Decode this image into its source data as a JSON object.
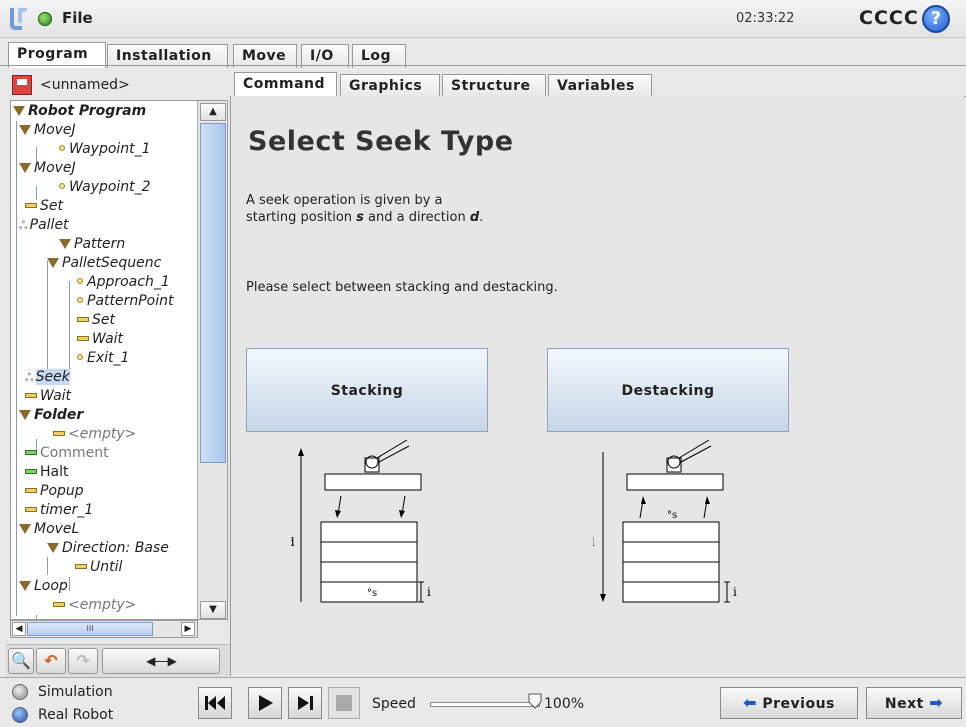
{
  "header": {
    "menu_label": "File",
    "clock": "02:33:22",
    "robot_name": "CCCC",
    "help_glyph": "?"
  },
  "main_tabs": [
    "Program",
    "Installation",
    "Move",
    "I/O",
    "Log"
  ],
  "program_name": "<unnamed>",
  "sub_tabs": [
    "Command",
    "Graphics",
    "Structure",
    "Variables"
  ],
  "tree": [
    {
      "label": "Robot Program"
    },
    {
      "label": "MoveJ"
    },
    {
      "label": "Waypoint_1"
    },
    {
      "label": "MoveJ"
    },
    {
      "label": "Waypoint_2"
    },
    {
      "label": "Set"
    },
    {
      "label": "Pallet"
    },
    {
      "label": "Pattern"
    },
    {
      "label": "PalletSequenc"
    },
    {
      "label": "Approach_1"
    },
    {
      "label": "PatternPoint"
    },
    {
      "label": "Set"
    },
    {
      "label": "Wait"
    },
    {
      "label": "Exit_1"
    },
    {
      "label": "Seek"
    },
    {
      "label": "Wait"
    },
    {
      "label": "Folder"
    },
    {
      "label": "<empty>"
    },
    {
      "label": "Comment"
    },
    {
      "label": "Halt"
    },
    {
      "label": "Popup"
    },
    {
      "label": "timer_1"
    },
    {
      "label": "MoveL"
    },
    {
      "label": "Direction: Base"
    },
    {
      "label": "Until"
    },
    {
      "label": "Loop"
    },
    {
      "label": "<empty>"
    }
  ],
  "tree_hscroll_glyph": "III",
  "toolbar": {
    "search_glyph": "🔍",
    "undo_glyph": "↶",
    "redo_glyph": "↷",
    "move_glyph": "◀----▶"
  },
  "content": {
    "title": "Select Seek Type",
    "desc_line1": "A seek operation is given by a",
    "desc_line2_prefix": "starting position ",
    "desc_s": "s",
    "desc_line2_mid": " and a direction ",
    "desc_d": "d",
    "desc_line2_end": ".",
    "instruction": "Please select between stacking and destacking.",
    "stacking_button": "Stacking",
    "destacking_button": "Destacking",
    "diagram_labels": {
      "d": "d",
      "s": "°s",
      "i": "i"
    }
  },
  "bottom": {
    "simulation_label": "Simulation",
    "real_robot_label": "Real Robot",
    "speed_label": "Speed",
    "speed_value": "100%",
    "speed_fraction": 1.0,
    "previous_label": "Previous",
    "next_label": "Next"
  }
}
